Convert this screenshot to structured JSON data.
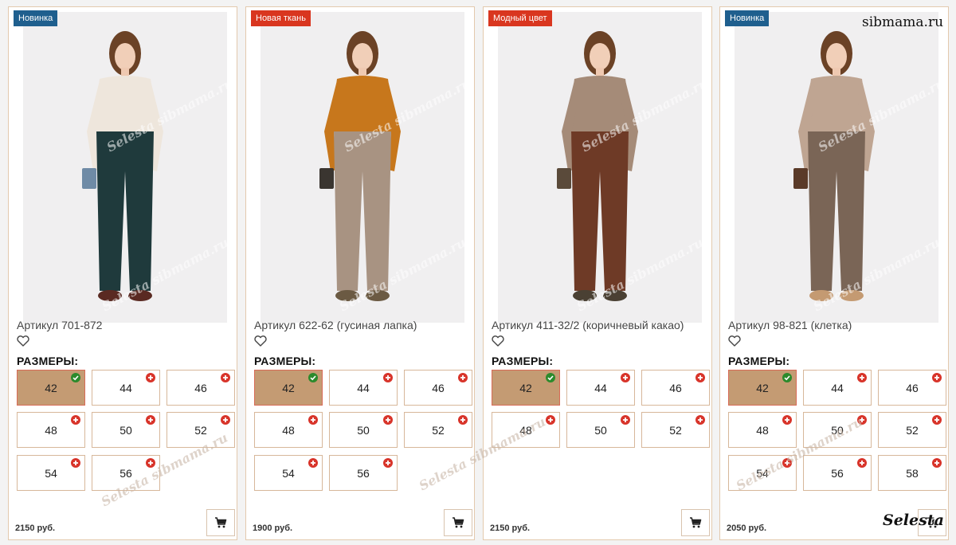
{
  "site_label": "sibmama.ru",
  "watermark_text": "Selesta sibmama.ru",
  "bottom_logo": "Selesta",
  "sizes_heading": "РАЗМЕРЫ:",
  "colors": {
    "badge_blue": "#1f5f8e",
    "badge_red": "#d9361f",
    "selected_size": "#c49b73",
    "available_mark": "#2c8a2c",
    "unavailable_mark": "#d8342a"
  },
  "products": [
    {
      "badge": "Новинка",
      "badge_color": "#1f5f8e",
      "title": "Артикул 701-872",
      "price": "2150 руб.",
      "sizes": [
        {
          "label": "42",
          "selected": true,
          "status": "available"
        },
        {
          "label": "44",
          "selected": false,
          "status": "unavailable"
        },
        {
          "label": "46",
          "selected": false,
          "status": "unavailable"
        },
        {
          "label": "48",
          "selected": false,
          "status": "unavailable"
        },
        {
          "label": "50",
          "selected": false,
          "status": "unavailable"
        },
        {
          "label": "52",
          "selected": false,
          "status": "unavailable"
        },
        {
          "label": "54",
          "selected": false,
          "status": "unavailable"
        },
        {
          "label": "56",
          "selected": false,
          "status": "unavailable"
        }
      ],
      "photo": {
        "top_color": "#eee6dc",
        "bottom_color": "#1f3a3c",
        "shoe_color": "#5a2a22",
        "bag_color": "#6f8ba6"
      }
    },
    {
      "badge": "Новая ткань",
      "badge_color": "#d9361f",
      "title": "Артикул 622-62 (гусиная лапка)",
      "price": "1900 руб.",
      "sizes": [
        {
          "label": "42",
          "selected": true,
          "status": "available"
        },
        {
          "label": "44",
          "selected": false,
          "status": "unavailable"
        },
        {
          "label": "46",
          "selected": false,
          "status": "unavailable"
        },
        {
          "label": "48",
          "selected": false,
          "status": "unavailable"
        },
        {
          "label": "50",
          "selected": false,
          "status": "unavailable"
        },
        {
          "label": "52",
          "selected": false,
          "status": "unavailable"
        },
        {
          "label": "54",
          "selected": false,
          "status": "unavailable"
        },
        {
          "label": "56",
          "selected": false,
          "status": "unavailable"
        }
      ],
      "photo": {
        "top_color": "#c7771c",
        "bottom_color": "#a89382",
        "shoe_color": "#6b5a43",
        "bag_color": "#3a3530"
      }
    },
    {
      "badge": "Модный цвет",
      "badge_color": "#d9361f",
      "title": "Артикул 411-32/2 (коричневый какао)",
      "price": "2150 руб.",
      "sizes": [
        {
          "label": "42",
          "selected": true,
          "status": "available"
        },
        {
          "label": "44",
          "selected": false,
          "status": "unavailable"
        },
        {
          "label": "46",
          "selected": false,
          "status": "unavailable"
        },
        {
          "label": "48",
          "selected": false,
          "status": "unavailable"
        },
        {
          "label": "50",
          "selected": false,
          "status": "unavailable"
        },
        {
          "label": "52",
          "selected": false,
          "status": "unavailable"
        }
      ],
      "photo": {
        "top_color": "#a58b78",
        "bottom_color": "#6e3a26",
        "shoe_color": "#4a4033",
        "bag_color": "#5a4a3a"
      }
    },
    {
      "badge": "Новинка",
      "badge_color": "#1f5f8e",
      "title": "Артикул 98-821 (клетка)",
      "price": "2050 руб.",
      "sizes": [
        {
          "label": "42",
          "selected": true,
          "status": "available"
        },
        {
          "label": "44",
          "selected": false,
          "status": "unavailable"
        },
        {
          "label": "46",
          "selected": false,
          "status": "unavailable"
        },
        {
          "label": "48",
          "selected": false,
          "status": "unavailable"
        },
        {
          "label": "50",
          "selected": false,
          "status": "unavailable"
        },
        {
          "label": "52",
          "selected": false,
          "status": "unavailable"
        },
        {
          "label": "54",
          "selected": false,
          "status": "unavailable"
        },
        {
          "label": "56",
          "selected": false,
          "status": "unavailable"
        },
        {
          "label": "58",
          "selected": false,
          "status": "unavailable"
        }
      ],
      "photo": {
        "top_color": "#bfa592",
        "bottom_color": "#7a6556",
        "shoe_color": "#c49a72",
        "bag_color": "#5a3a28"
      }
    }
  ]
}
